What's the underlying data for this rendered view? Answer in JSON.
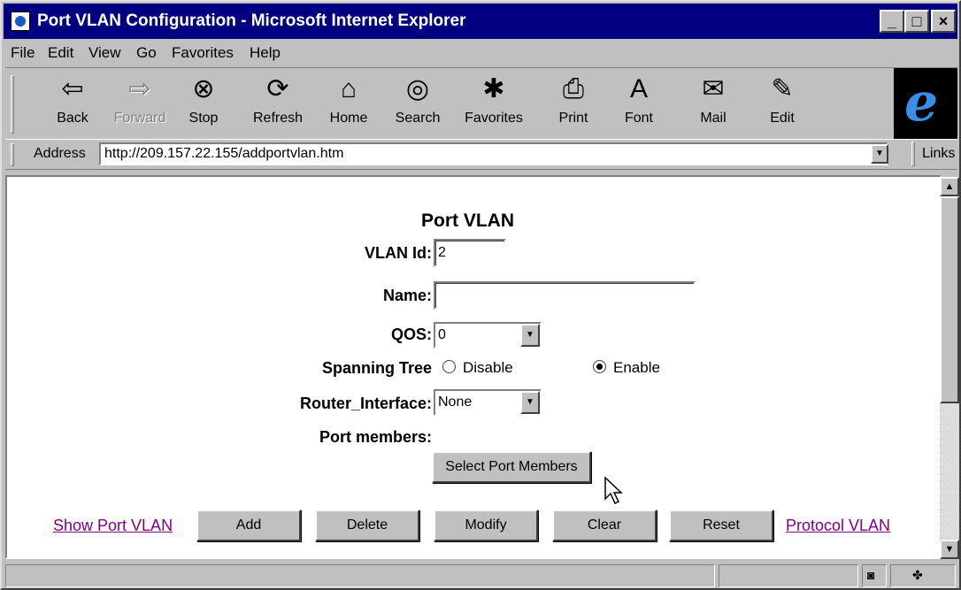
{
  "window": {
    "title": "Port VLAN Configuration - Microsoft Internet Explorer",
    "minimize": "_",
    "maximize": "□",
    "close": "×"
  },
  "menu": [
    "File",
    "Edit",
    "View",
    "Go",
    "Favorites",
    "Help"
  ],
  "toolbar": {
    "back": "Back",
    "forward": "Forward",
    "stop": "Stop",
    "refresh": "Refresh",
    "home": "Home",
    "search": "Search",
    "favorites": "Favorites",
    "print": "Print",
    "font": "Font",
    "mail": "Mail",
    "edit": "Edit"
  },
  "address": {
    "label": "Address",
    "url": "http://209.157.22.155/addportvlan.htm",
    "links": "Links"
  },
  "form": {
    "title": "Port VLAN",
    "vlan_id_label": "VLAN Id:",
    "vlan_id_value": "2",
    "name_label": "Name:",
    "name_value": "",
    "qos_label": "QOS:",
    "qos_value": "0",
    "spanning_tree_label": "Spanning Tree",
    "spanning_disable": "Disable",
    "spanning_enable": "Enable",
    "spanning_selected": "Enable",
    "router_interface_label": "Router_Interface:",
    "router_interface_value": "None",
    "port_members_label": "Port members:",
    "select_port_members": "Select Port Members"
  },
  "actions": {
    "show_port_vlan": "Show Port VLAN",
    "add": "Add",
    "delete": "Delete",
    "modify": "Modify",
    "clear": "Clear",
    "reset": "Reset",
    "protocol_vlan": "Protocol VLAN"
  },
  "colors": {
    "titlebar": "#000080",
    "chrome": "#c0c0c0",
    "visited_link": "#800080"
  }
}
